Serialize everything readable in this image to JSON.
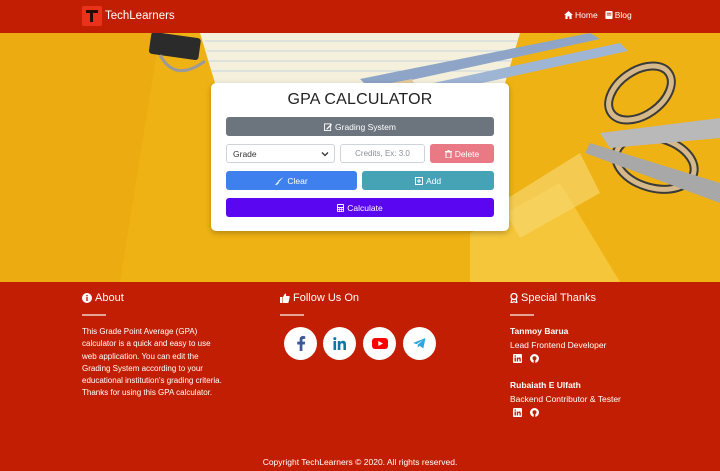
{
  "navbar": {
    "brand": "TechLearners",
    "links": [
      {
        "label": "Home",
        "icon": "home-icon"
      },
      {
        "label": "Blog",
        "icon": "book-icon"
      }
    ]
  },
  "calculator": {
    "title": "GPA CALCULATOR",
    "grading_label": "Grading System",
    "grade_select_value": "Grade",
    "credits_placeholder": "Credits, Ex: 3.0",
    "delete_label": "Delete",
    "clear_label": "Clear",
    "add_label": "Add",
    "calculate_label": "Calculate"
  },
  "footer": {
    "about": {
      "title": "About",
      "text": "This Grade Point Average (GPA) calculator is a quick and easy to use web application. You can edit the Grading System according to your educational institution's grading criteria. Thanks for using this GPA calculator."
    },
    "follow": {
      "title": "Follow Us On",
      "networks": [
        "facebook-icon",
        "linkedin-icon",
        "youtube-icon",
        "telegram-icon"
      ]
    },
    "thanks": {
      "title": "Special Thanks",
      "people": [
        {
          "name": "Tanmoy Barua",
          "role": "Lead Frontend Developer"
        },
        {
          "name": "Rubaiath E Ulfath",
          "role": "Backend Contributor & Tester"
        }
      ]
    },
    "copyright": "Copyright TechLearners © 2020. All rights reserved."
  },
  "colors": {
    "brand_red": "#c21e04",
    "hero_yellow": "#f0b415",
    "grading_gray": "#6c757d",
    "delete_pink": "#e97a85",
    "clear_blue": "#3d80ee",
    "add_teal": "#45a3b5",
    "calculate_purple": "#5b06f0"
  }
}
